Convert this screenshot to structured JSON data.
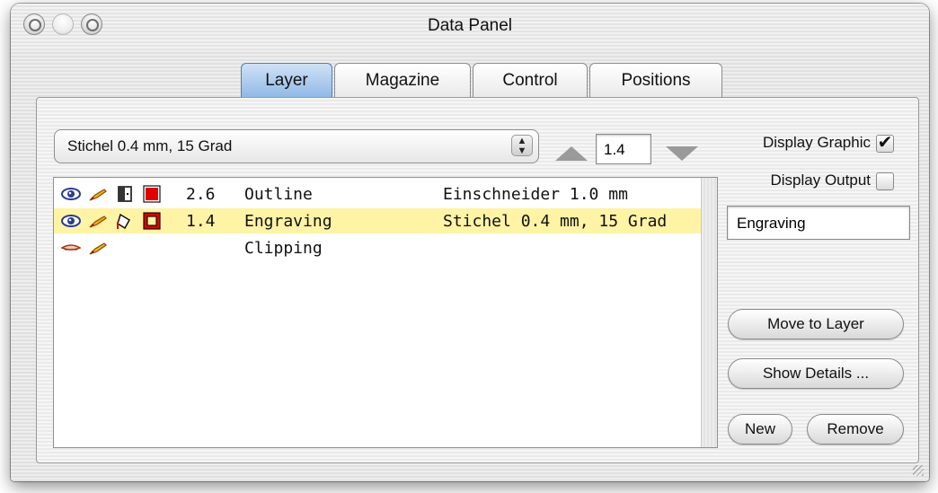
{
  "window": {
    "title": "Data Panel"
  },
  "tabs": [
    {
      "label": "Layer",
      "active": true
    },
    {
      "label": "Magazine",
      "active": false
    },
    {
      "label": "Control",
      "active": false
    },
    {
      "label": "Positions",
      "active": false
    }
  ],
  "tool_popup": {
    "value": "Stichel 0.4 mm, 15 Grad"
  },
  "depth_stepper": {
    "value": "1.4"
  },
  "display_graphic": {
    "label": "Display Graphic",
    "checked": true
  },
  "display_output": {
    "label": "Display Output",
    "checked": false
  },
  "layer_name_field": {
    "value": "Engraving"
  },
  "buttons": {
    "move_to_layer": "Move to Layer",
    "show_details": "Show Details ...",
    "new": "New",
    "remove": "Remove"
  },
  "layers": [
    {
      "value": "2.6",
      "name": "Outline",
      "tool": "Einschneider 1.0 mm",
      "selected": false,
      "icons": [
        "eye-icon",
        "pen-icon",
        "door-icon",
        "color-swatch-icon"
      ]
    },
    {
      "value": "1.4",
      "name": "Engraving",
      "tool": "Stichel 0.4 mm, 15 Grad",
      "selected": true,
      "icons": [
        "eye-icon",
        "pen-icon",
        "paint-bucket-icon",
        "color-swatch-icon"
      ]
    },
    {
      "value": "",
      "name": "Clipping",
      "tool": "",
      "selected": false,
      "icons": [
        "eye-closed-icon",
        "pen-icon"
      ]
    }
  ],
  "colors": {
    "selection": "#fff3a6",
    "swatch_red": "#e00000",
    "tab_active": "#8fb8e6"
  }
}
